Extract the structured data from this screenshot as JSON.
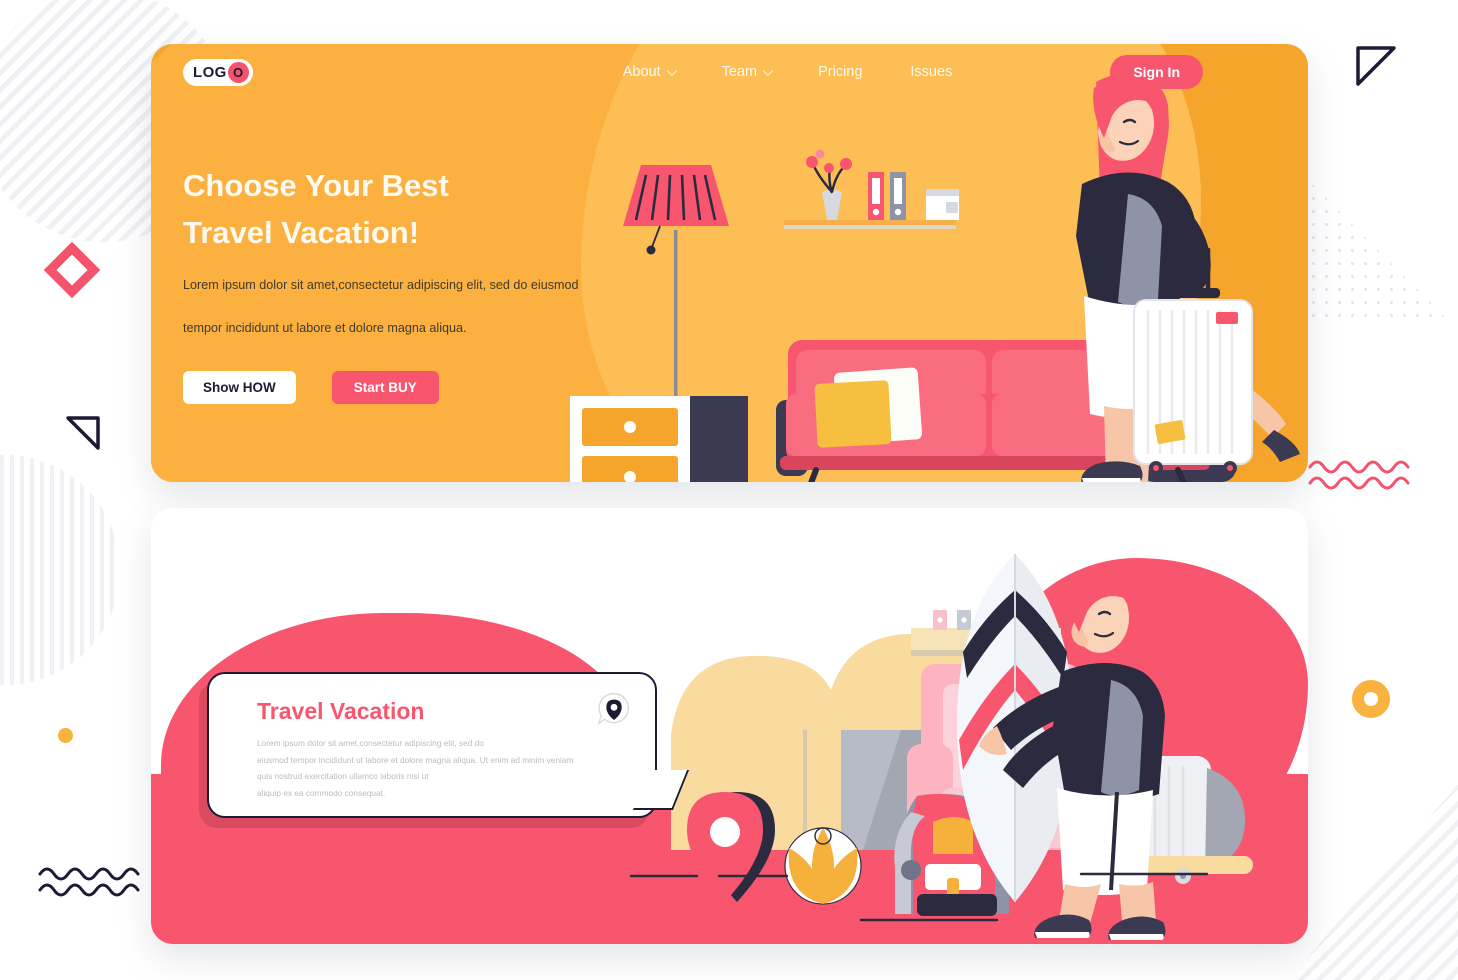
{
  "page": {
    "background_color": "#ffffff",
    "accent_orange": "#f6a52c",
    "accent_pink": "#f8566f",
    "accent_navy": "#1d1b33"
  },
  "hero": {
    "background_color": "#f6a52c",
    "logo": {
      "text": "LOG",
      "badge_letter": "O"
    },
    "nav": [
      {
        "label": "About",
        "has_chevron": true
      },
      {
        "label": "Team",
        "has_chevron": true
      },
      {
        "label": "Pricing",
        "has_chevron": false
      },
      {
        "label": "Issues",
        "has_chevron": false
      }
    ],
    "signin_label": "Sign In",
    "title_line1": "Choose Your Best",
    "title_line2": "Travel Vacation!",
    "subtitle_line1": "Lorem ipsum dolor sit amet,consectetur adipiscing elit, sed do eiusmod",
    "subtitle_line2": "tempor incididunt ut labore et dolore magna aliqua.",
    "primary_button": "Show HOW",
    "secondary_button": "Start BUY",
    "illustration": {
      "name": "woman-with-suitcase-in-living-room",
      "elements": [
        "floor-lamp",
        "nightstand",
        "wall-socket",
        "shelf-with-vase-and-books",
        "pink-sofa",
        "armchair",
        "woman-traveler",
        "rolling-suitcase"
      ]
    }
  },
  "second": {
    "background_color": "#ffffff",
    "card_title": "Travel Vacation",
    "card_text_line1": "Lorem ipsum dolor sit amet,consectetur adipiscing elit, sed do",
    "card_text_line2": "eiusmod tempor incididunt ut labore et dolore magna aliqua. Ut enim ad minim veniam",
    "card_text_line3": "quis nostrud exercitation ullamco laboris nisi ut",
    "card_text_line4": "aliquip ex ea commodo consequat.",
    "card_icon": "map-pin-bubble-icon",
    "illustration": {
      "name": "traveler-with-surfboard",
      "elements": [
        "dresser",
        "armchair",
        "map-pin-marker",
        "beach-ball",
        "backpack",
        "surfboard",
        "traveler",
        "rolling-suitcase"
      ]
    }
  },
  "decorations": [
    {
      "name": "striped-circle-top-left",
      "color": "#eef0f3"
    },
    {
      "name": "diamond-outline",
      "color": "#f4546b"
    },
    {
      "name": "triangle-outline-left",
      "color": "#1d1b33"
    },
    {
      "name": "striped-circle-left",
      "color": "#f0f1f4"
    },
    {
      "name": "wavy-lines-navy",
      "color": "#1d1b33"
    },
    {
      "name": "dot-orange",
      "color": "#f9b23e"
    },
    {
      "name": "triangle-outline-top-right",
      "color": "#1d1b33"
    },
    {
      "name": "dotted-triangle",
      "color": "#dfe2e7"
    },
    {
      "name": "wavy-lines-pink",
      "color": "#f4546b"
    },
    {
      "name": "ring-orange",
      "color": "#f9b23e"
    },
    {
      "name": "striped-square-bottom-right",
      "color": "#eff1f4"
    }
  ]
}
